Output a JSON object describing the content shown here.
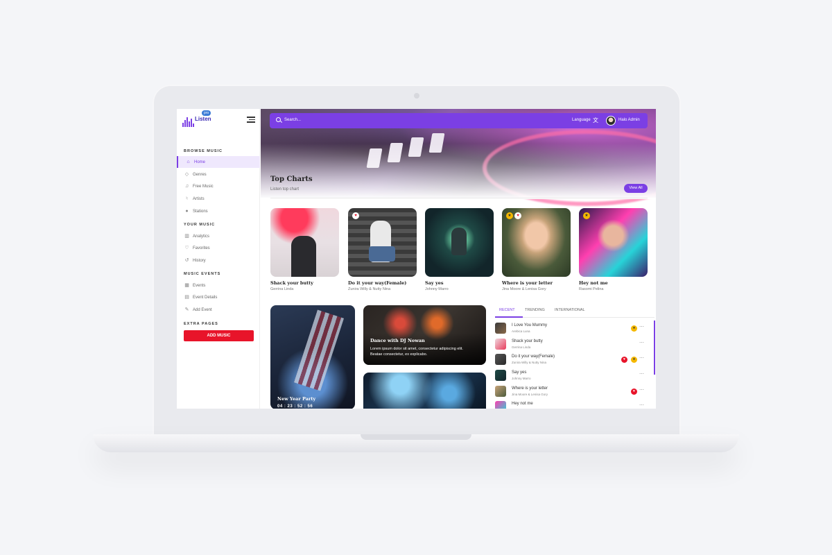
{
  "app": {
    "logo_text": "Listen",
    "logo_badge": "pro"
  },
  "sidebar": {
    "sections": [
      {
        "title": "BROWSE MUSIC"
      },
      {
        "title": "YOUR MUSIC"
      },
      {
        "title": "MUSIC EVENTS"
      },
      {
        "title": "EXTRA PAGES"
      }
    ],
    "items": [
      {
        "label": "Home",
        "icon": "home-icon"
      },
      {
        "label": "Genres",
        "icon": "diamond-icon"
      },
      {
        "label": "Free Music",
        "icon": "music-note-icon"
      },
      {
        "label": "Artists",
        "icon": "microphone-icon"
      },
      {
        "label": "Stations",
        "icon": "radio-icon"
      },
      {
        "label": "Analytics",
        "icon": "bar-chart-icon"
      },
      {
        "label": "Favorites",
        "icon": "heart-icon"
      },
      {
        "label": "History",
        "icon": "history-icon"
      },
      {
        "label": "Events",
        "icon": "calendar-icon"
      },
      {
        "label": "Event Details",
        "icon": "document-icon"
      },
      {
        "label": "Add Event",
        "icon": "edit-icon"
      }
    ],
    "add_music_label": "ADD MUSIC"
  },
  "topbar": {
    "search_placeholder": "Search...",
    "language_label": "Language",
    "user_name": "Halo Admin"
  },
  "hero": {
    "title": "Top Charts",
    "subtitle": "Listen top chart",
    "view_all_label": "View All"
  },
  "top_charts": [
    {
      "title": "Shack your butty",
      "artist": "Gerrina Linda"
    },
    {
      "title": "Do it your way(Female)",
      "artist": "Zunira Willy & Nutty Nina"
    },
    {
      "title": "Say yes",
      "artist": "Johnny Marro"
    },
    {
      "title": "Where is your letter",
      "artist": "Jina Moore & Lenisa Gory"
    },
    {
      "title": "Hey not me",
      "artist": "Rasomi Pelina"
    }
  ],
  "events": {
    "new_year": {
      "title": "New Year Party",
      "countdown": "04 : 23 : 52 : 56"
    },
    "dj": {
      "title": "Dance with DJ Nowan",
      "description": "Lorem ipsum dolor sit amet, consectetur adipiscing elit. Beatae consectetur, ex explicabo."
    }
  },
  "tabs": [
    {
      "label": "RECENT"
    },
    {
      "label": "TRENDING"
    },
    {
      "label": "INTERNATIONAL"
    }
  ],
  "recent": [
    {
      "title": "I Love You Mummy",
      "artist": "Arebica Luna"
    },
    {
      "title": "Shack your butty",
      "artist": "Gerrina Linda"
    },
    {
      "title": "Do it your way(Female)",
      "artist": "Zunira Willy & Nutty Nina"
    },
    {
      "title": "Say yes",
      "artist": "Johnny Marro"
    },
    {
      "title": "Where is your letter",
      "artist": "Jina Moore & Lenisa Gory"
    },
    {
      "title": "Hey not me",
      "artist": ""
    }
  ],
  "colors": {
    "accent": "#7b3fe4",
    "danger": "#e8142a",
    "star": "#f5b800"
  }
}
